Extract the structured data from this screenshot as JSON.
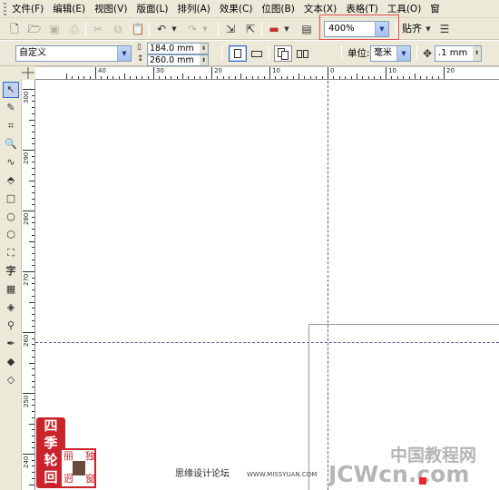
{
  "menubar": {
    "items": [
      "文件(F)",
      "编辑(E)",
      "视图(V)",
      "版面(L)",
      "排列(A)",
      "效果(C)",
      "位图(B)",
      "文本(X)",
      "表格(T)",
      "工具(O)",
      "窗"
    ]
  },
  "standard_toolbar": {
    "zoom_level": "400%",
    "snap_label": "贴齐"
  },
  "property_bar": {
    "page_size": "自定义",
    "width": "184.0 mm",
    "height": "260.0 mm",
    "unit_label": "单位:",
    "unit_value": "毫米",
    "nudge_value": ".1 mm"
  },
  "ruler_h": {
    "labels": [
      "40",
      "30",
      "20",
      "10",
      "0",
      "10",
      "20"
    ]
  },
  "ruler_v": {
    "labels": [
      "300",
      "290",
      "280",
      "270",
      "260",
      "250",
      "240"
    ]
  },
  "toolbox": {
    "tools": [
      "pick-tool",
      "shape-tool",
      "crop-tool",
      "zoom-tool",
      "freehand-tool",
      "smart-fill-tool",
      "rectangle-tool",
      "ellipse-tool",
      "polygon-tool",
      "basic-shapes-tool",
      "text-tool",
      "table-tool",
      "interactive-tool",
      "eyedropper-tool",
      "outline-tool",
      "fill-tool",
      "interactive-fill-tool"
    ],
    "text_tool_glyph": "字"
  },
  "watermark": {
    "seal_chars": [
      "四",
      "季",
      "轮",
      "回"
    ],
    "seal2_chars": [
      "丽",
      "迥",
      "独",
      "窗"
    ],
    "caption": "思缘设计论坛",
    "url": "WWW.MISSYUAN.COM",
    "brand_cn": "中国教程网",
    "brand_en": "JCWcn.com"
  },
  "colors": {
    "ui_bg": "#ece9d8",
    "highlight": "#e05050",
    "guide": "#5a5a9a",
    "seal_red": "#c9232c"
  }
}
